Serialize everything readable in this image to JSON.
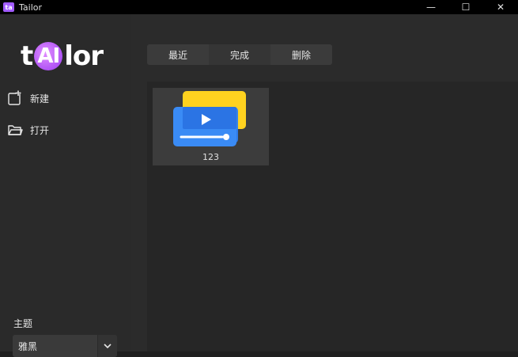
{
  "window": {
    "title": "Tailor",
    "icon_text": "ta",
    "controls": {
      "minimize": "—",
      "maximize": "☐",
      "close": "✕"
    }
  },
  "sidebar": {
    "logo": {
      "left": "t",
      "middle": "AI",
      "right": "lor"
    },
    "items": [
      {
        "label": "新建",
        "icon": "new-file-icon"
      },
      {
        "label": "打开",
        "icon": "folder-open-icon"
      }
    ],
    "theme": {
      "label": "主题",
      "value": "雅黑"
    }
  },
  "main": {
    "tabs": [
      {
        "label": "最近"
      },
      {
        "label": "完成"
      },
      {
        "label": "删除"
      }
    ],
    "items": [
      {
        "name": "123",
        "icon": "video-files-icon"
      }
    ]
  },
  "colors": {
    "background": "#1f1f1f",
    "sidebar": "#2a2a2a",
    "accent_purple": "#a25cff",
    "video_blue": "#2e7ef0",
    "video_yellow": "#ffd21f"
  }
}
